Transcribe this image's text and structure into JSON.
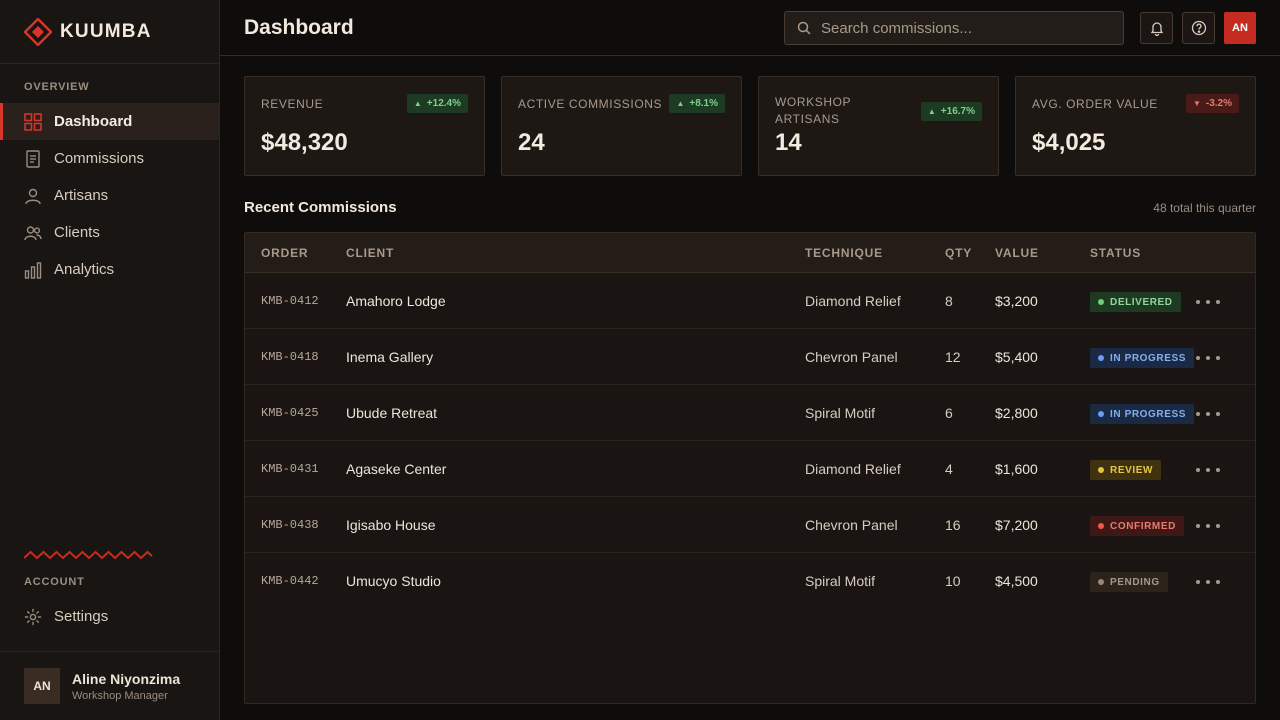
{
  "app": {
    "name": "KUUMBA"
  },
  "sidebar": {
    "overview_label": "OVERVIEW",
    "items": [
      {
        "label": "Dashboard",
        "icon": "grid-icon",
        "active": true
      },
      {
        "label": "Commissions",
        "icon": "document-icon",
        "active": false
      },
      {
        "label": "Artisans",
        "icon": "person-icon",
        "active": false
      },
      {
        "label": "Clients",
        "icon": "people-icon",
        "active": false
      },
      {
        "label": "Analytics",
        "icon": "bar-chart-icon",
        "active": false
      }
    ],
    "account_label": "ACCOUNT",
    "settings_label": "Settings",
    "user": {
      "initials": "AN",
      "name": "Aline Niyonzima",
      "role": "Workshop Manager"
    }
  },
  "header": {
    "title": "Dashboard",
    "search_placeholder": "Search commissions...",
    "avatar_initials": "AN"
  },
  "stats": [
    {
      "label": "REVENUE",
      "value": "$48,320",
      "delta": "+12.4%",
      "direction": "up"
    },
    {
      "label": "ACTIVE COMMISSIONS",
      "value": "24",
      "delta": "+8.1%",
      "direction": "up"
    },
    {
      "label": "WORKSHOP ARTISANS",
      "value": "14",
      "delta": "+16.7%",
      "direction": "up"
    },
    {
      "label": "AVG. ORDER VALUE",
      "value": "$4,025",
      "delta": "-3.2%",
      "direction": "down"
    }
  ],
  "recent": {
    "title": "Recent Commissions",
    "meta": "48 total this quarter",
    "columns": {
      "order": "ORDER",
      "client": "CLIENT",
      "technique": "TECHNIQUE",
      "qty": "QTY",
      "value": "VALUE",
      "status": "STATUS"
    },
    "rows": [
      {
        "order": "KMB-0412",
        "client": "Amahoro Lodge",
        "technique": "Diamond Relief",
        "qty": "8",
        "value": "$3,200",
        "status": "DELIVERED",
        "status_kind": "delivered"
      },
      {
        "order": "KMB-0418",
        "client": "Inema Gallery",
        "technique": "Chevron Panel",
        "qty": "12",
        "value": "$5,400",
        "status": "IN PROGRESS",
        "status_kind": "progress"
      },
      {
        "order": "KMB-0425",
        "client": "Ubude Retreat",
        "technique": "Spiral Motif",
        "qty": "6",
        "value": "$2,800",
        "status": "IN PROGRESS",
        "status_kind": "progress"
      },
      {
        "order": "KMB-0431",
        "client": "Agaseke Center",
        "technique": "Diamond Relief",
        "qty": "4",
        "value": "$1,600",
        "status": "REVIEW",
        "status_kind": "review"
      },
      {
        "order": "KMB-0438",
        "client": "Igisabo House",
        "technique": "Chevron Panel",
        "qty": "16",
        "value": "$7,200",
        "status": "CONFIRMED",
        "status_kind": "confirmed"
      },
      {
        "order": "KMB-0442",
        "client": "Umucyo Studio",
        "technique": "Spiral Motif",
        "qty": "10",
        "value": "$4,500",
        "status": "PENDING",
        "status_kind": "pending"
      }
    ]
  },
  "colors": {
    "accent": "#d9352a",
    "background": "#0f0d0b",
    "sidebar": "#191512"
  }
}
